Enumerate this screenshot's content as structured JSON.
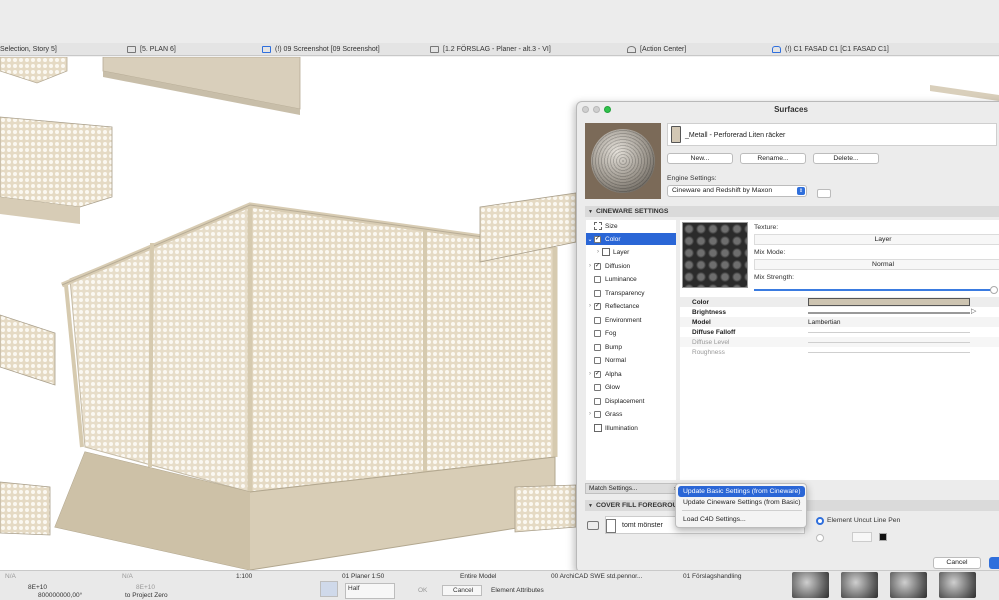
{
  "tabs": [
    {
      "label": "Selection, Story 5]"
    },
    {
      "label": "[5. PLAN 6]"
    },
    {
      "label": "(!) 09 Screenshot [09 Screenshot]"
    },
    {
      "label": "[1.2 FÖRSLAG - Planer - alt.3 - VI]"
    },
    {
      "label": "[Action Center]"
    },
    {
      "label": "(!) C1 FASAD C1 [C1 FASAD C1]"
    }
  ],
  "dialog": {
    "title": "Surfaces",
    "material_name": "_Metall - Perforerad Liten räcker",
    "buttons": {
      "new": "New...",
      "rename": "Rename...",
      "delete": "Delete..."
    },
    "engine_settings_label": "Engine Settings:",
    "engine_value": "Cineware and Redshift by Maxon",
    "cineware_header": "CINEWARE SETTINGS",
    "tree": [
      {
        "label": "Size",
        "type": "size"
      },
      {
        "label": "Color",
        "type": "check",
        "checked": true,
        "expanded": true,
        "selected": true
      },
      {
        "label": "Layer",
        "type": "layer",
        "indent": true
      },
      {
        "label": "Diffusion",
        "type": "check",
        "checked": true,
        "expand": true
      },
      {
        "label": "Luminance",
        "type": "check",
        "checked": false
      },
      {
        "label": "Transparency",
        "type": "check",
        "checked": false
      },
      {
        "label": "Reflectance",
        "type": "check",
        "checked": true,
        "expand": true
      },
      {
        "label": "Environment",
        "type": "check",
        "checked": false
      },
      {
        "label": "Fog",
        "type": "check",
        "checked": false
      },
      {
        "label": "Bump",
        "type": "check",
        "checked": false
      },
      {
        "label": "Normal",
        "type": "check",
        "checked": false
      },
      {
        "label": "Alpha",
        "type": "check",
        "checked": true,
        "expand": true
      },
      {
        "label": "Glow",
        "type": "check",
        "checked": false
      },
      {
        "label": "Displacement",
        "type": "check",
        "checked": false
      },
      {
        "label": "Grass",
        "type": "check",
        "checked": false,
        "expand": true
      },
      {
        "label": "Illumination",
        "type": "illum"
      }
    ],
    "texture_label": "Texture:",
    "texture_value": "Layer",
    "mix_mode_label": "Mix Mode:",
    "mix_mode_value": "Normal",
    "mix_strength_label": "Mix Strength:",
    "props": [
      {
        "name": "Color"
      },
      {
        "name": "Brightness"
      },
      {
        "name": "Model",
        "value": "Lambertian"
      },
      {
        "name": "Diffuse Falloff"
      },
      {
        "name": "Diffuse Level",
        "disabled": true
      },
      {
        "name": "Roughness",
        "disabled": true
      }
    ],
    "match_settings": "Match Settings...",
    "cover_fill_header": "COVER FILL FOREGROUN",
    "cover_fill_value": "tomt mönster",
    "uncut_line_label": "Element Uncut Line Pen",
    "cancel": "Cancel"
  },
  "menu": {
    "items": [
      {
        "label": "Update Basic Settings (from Cineware)",
        "highlighted": true
      },
      {
        "label": "Update Cineware Settings (from Basic)"
      },
      {
        "label": "Load C4D Settings..."
      }
    ]
  },
  "statusbar": {
    "na1": "N/A",
    "na2": "N/A",
    "dx": "8E+10",
    "dx2": "8E+10",
    "coord": "800000000,00°",
    "project_zero": "to Project Zero",
    "scale": "1:100",
    "layer_combo": "01 Planer 1:50",
    "model": "Entire Model",
    "pen_set": "00 ArchiCAD SWE std.pennor...",
    "graphic_override": "01 Förslagshandling",
    "half": "Half",
    "ok": "OK",
    "cancel": "Cancel",
    "element_attributes": "Element Attributes"
  }
}
